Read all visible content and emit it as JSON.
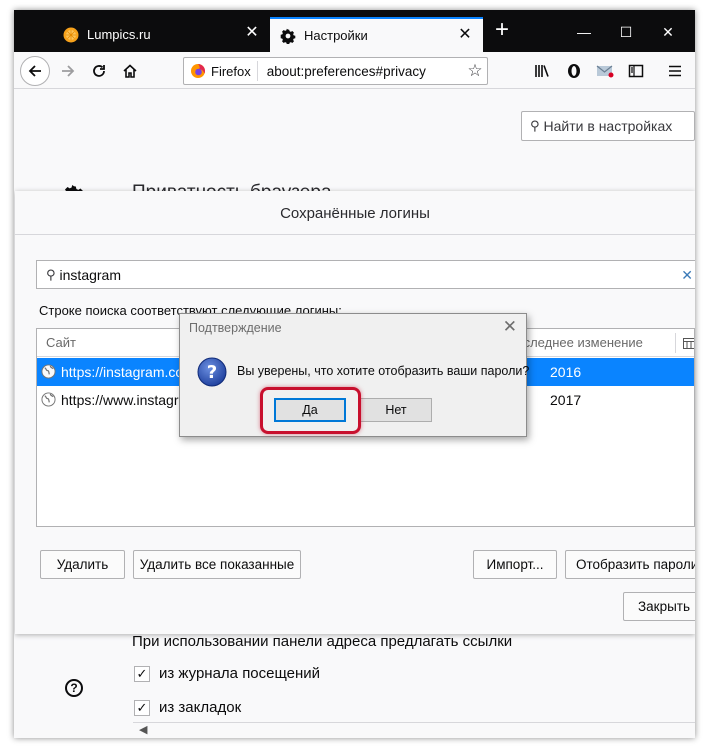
{
  "colors": {
    "accent": "#0a84ff",
    "highlight_ring": "#c8102e",
    "tabstrip": "#0c0c0d"
  },
  "tabs": [
    {
      "label": "Lumpics.ru",
      "icon": "orange-favicon",
      "close": "✕"
    },
    {
      "label": "Настройки",
      "icon": "gear-icon",
      "close": "✕",
      "selected": true
    }
  ],
  "window_controls": {
    "new_tab": "+",
    "minimize": "—",
    "maximize": "☐",
    "close": "✕"
  },
  "toolbar": {
    "identity_label": "Firefox",
    "url": "about:preferences#privacy",
    "star": "☆",
    "icons": [
      "back-icon",
      "forward-icon",
      "reload-icon",
      "home-icon",
      "library-icon",
      "sidebar-icon",
      "menu-icon"
    ]
  },
  "prefs": {
    "search_placeholder": "Найти в настройках",
    "title": "Приватность браузера",
    "address_bar_label": "При использовании панели адреса предлагать ссылки",
    "checkbox_history": "из журнала посещений",
    "checkbox_bookmarks": "из закладок",
    "check_mark": "✓",
    "help": "?"
  },
  "saved_logins": {
    "title": "Сохранённые логины",
    "filter_value": "instagram",
    "clear": "✕",
    "match_label": "Строке поиска соответствуют следующие логины:",
    "columns": {
      "site": "Сайт",
      "last_changed": "Последнее изменение"
    },
    "rows": [
      {
        "site": "https://instagram.com",
        "changed": "2016",
        "selected": true
      },
      {
        "site": "https://www.instagram.com",
        "changed": "2017",
        "selected": false
      }
    ],
    "buttons": {
      "remove": "Удалить",
      "remove_all": "Удалить все показанные",
      "import": "Импорт...",
      "show_passwords": "Отобразить пароли",
      "close": "Закрыть"
    }
  },
  "confirm": {
    "title": "Подтверждение",
    "close": "✕",
    "message": "Вы уверены, что хотите отобразить ваши пароли?",
    "yes": "Да",
    "no": "Нет"
  }
}
